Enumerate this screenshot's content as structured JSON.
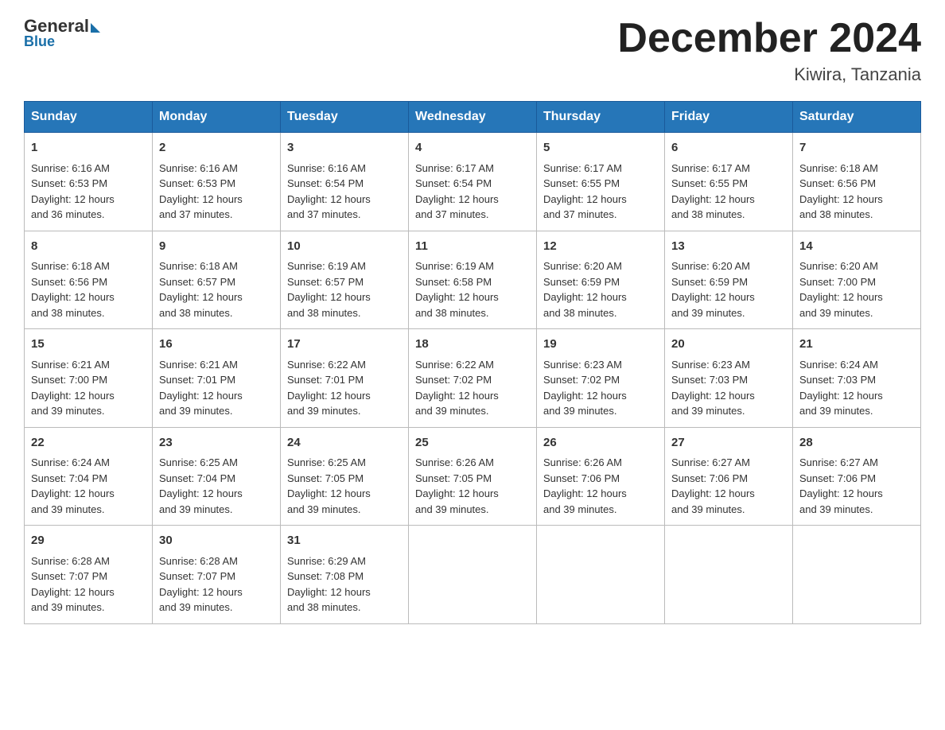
{
  "header": {
    "logo_general": "General",
    "logo_blue": "Blue",
    "month_title": "December 2024",
    "location": "Kiwira, Tanzania"
  },
  "weekdays": [
    "Sunday",
    "Monday",
    "Tuesday",
    "Wednesday",
    "Thursday",
    "Friday",
    "Saturday"
  ],
  "weeks": [
    [
      {
        "day": "1",
        "sunrise": "6:16 AM",
        "sunset": "6:53 PM",
        "daylight": "12 hours and 36 minutes."
      },
      {
        "day": "2",
        "sunrise": "6:16 AM",
        "sunset": "6:53 PM",
        "daylight": "12 hours and 37 minutes."
      },
      {
        "day": "3",
        "sunrise": "6:16 AM",
        "sunset": "6:54 PM",
        "daylight": "12 hours and 37 minutes."
      },
      {
        "day": "4",
        "sunrise": "6:17 AM",
        "sunset": "6:54 PM",
        "daylight": "12 hours and 37 minutes."
      },
      {
        "day": "5",
        "sunrise": "6:17 AM",
        "sunset": "6:55 PM",
        "daylight": "12 hours and 37 minutes."
      },
      {
        "day": "6",
        "sunrise": "6:17 AM",
        "sunset": "6:55 PM",
        "daylight": "12 hours and 38 minutes."
      },
      {
        "day": "7",
        "sunrise": "6:18 AM",
        "sunset": "6:56 PM",
        "daylight": "12 hours and 38 minutes."
      }
    ],
    [
      {
        "day": "8",
        "sunrise": "6:18 AM",
        "sunset": "6:56 PM",
        "daylight": "12 hours and 38 minutes."
      },
      {
        "day": "9",
        "sunrise": "6:18 AM",
        "sunset": "6:57 PM",
        "daylight": "12 hours and 38 minutes."
      },
      {
        "day": "10",
        "sunrise": "6:19 AM",
        "sunset": "6:57 PM",
        "daylight": "12 hours and 38 minutes."
      },
      {
        "day": "11",
        "sunrise": "6:19 AM",
        "sunset": "6:58 PM",
        "daylight": "12 hours and 38 minutes."
      },
      {
        "day": "12",
        "sunrise": "6:20 AM",
        "sunset": "6:59 PM",
        "daylight": "12 hours and 38 minutes."
      },
      {
        "day": "13",
        "sunrise": "6:20 AM",
        "sunset": "6:59 PM",
        "daylight": "12 hours and 39 minutes."
      },
      {
        "day": "14",
        "sunrise": "6:20 AM",
        "sunset": "7:00 PM",
        "daylight": "12 hours and 39 minutes."
      }
    ],
    [
      {
        "day": "15",
        "sunrise": "6:21 AM",
        "sunset": "7:00 PM",
        "daylight": "12 hours and 39 minutes."
      },
      {
        "day": "16",
        "sunrise": "6:21 AM",
        "sunset": "7:01 PM",
        "daylight": "12 hours and 39 minutes."
      },
      {
        "day": "17",
        "sunrise": "6:22 AM",
        "sunset": "7:01 PM",
        "daylight": "12 hours and 39 minutes."
      },
      {
        "day": "18",
        "sunrise": "6:22 AM",
        "sunset": "7:02 PM",
        "daylight": "12 hours and 39 minutes."
      },
      {
        "day": "19",
        "sunrise": "6:23 AM",
        "sunset": "7:02 PM",
        "daylight": "12 hours and 39 minutes."
      },
      {
        "day": "20",
        "sunrise": "6:23 AM",
        "sunset": "7:03 PM",
        "daylight": "12 hours and 39 minutes."
      },
      {
        "day": "21",
        "sunrise": "6:24 AM",
        "sunset": "7:03 PM",
        "daylight": "12 hours and 39 minutes."
      }
    ],
    [
      {
        "day": "22",
        "sunrise": "6:24 AM",
        "sunset": "7:04 PM",
        "daylight": "12 hours and 39 minutes."
      },
      {
        "day": "23",
        "sunrise": "6:25 AM",
        "sunset": "7:04 PM",
        "daylight": "12 hours and 39 minutes."
      },
      {
        "day": "24",
        "sunrise": "6:25 AM",
        "sunset": "7:05 PM",
        "daylight": "12 hours and 39 minutes."
      },
      {
        "day": "25",
        "sunrise": "6:26 AM",
        "sunset": "7:05 PM",
        "daylight": "12 hours and 39 minutes."
      },
      {
        "day": "26",
        "sunrise": "6:26 AM",
        "sunset": "7:06 PM",
        "daylight": "12 hours and 39 minutes."
      },
      {
        "day": "27",
        "sunrise": "6:27 AM",
        "sunset": "7:06 PM",
        "daylight": "12 hours and 39 minutes."
      },
      {
        "day": "28",
        "sunrise": "6:27 AM",
        "sunset": "7:06 PM",
        "daylight": "12 hours and 39 minutes."
      }
    ],
    [
      {
        "day": "29",
        "sunrise": "6:28 AM",
        "sunset": "7:07 PM",
        "daylight": "12 hours and 39 minutes."
      },
      {
        "day": "30",
        "sunrise": "6:28 AM",
        "sunset": "7:07 PM",
        "daylight": "12 hours and 39 minutes."
      },
      {
        "day": "31",
        "sunrise": "6:29 AM",
        "sunset": "7:08 PM",
        "daylight": "12 hours and 38 minutes."
      },
      null,
      null,
      null,
      null
    ]
  ],
  "labels": {
    "sunrise": "Sunrise:",
    "sunset": "Sunset:",
    "daylight": "Daylight:"
  }
}
